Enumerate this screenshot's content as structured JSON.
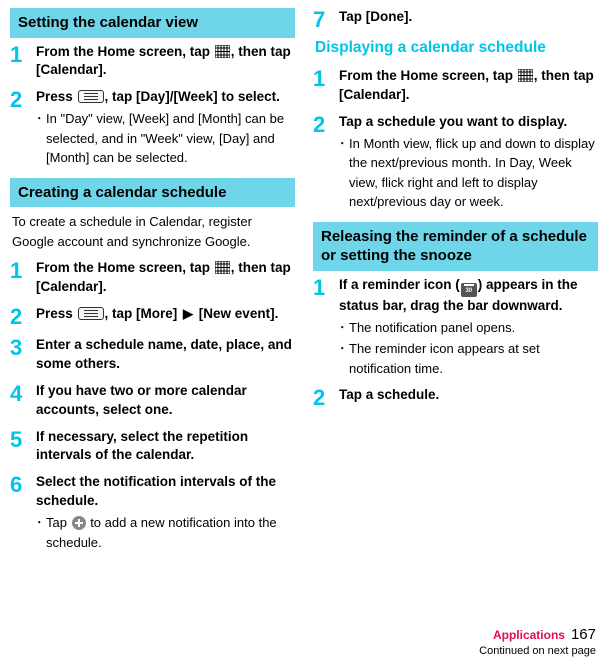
{
  "leftColumn": {
    "section1": {
      "header": "Setting the calendar view",
      "steps": [
        {
          "num": "1",
          "title_pre": "From the Home screen, tap ",
          "title_post": ", then tap [Calendar]."
        },
        {
          "num": "2",
          "title_pre": "Press ",
          "title_post": ", tap [Day]/[Week] to select.",
          "bullet": "In \"Day\" view, [Week] and [Month] can be selected, and in \"Week\" view, [Day] and [Month] can be selected."
        }
      ]
    },
    "section2": {
      "header": "Creating a calendar schedule",
      "intro": "To create a schedule in Calendar, register Google account and synchronize Google.",
      "steps": [
        {
          "num": "1",
          "title_pre": "From the Home screen, tap ",
          "title_post": ", then tap [Calendar]."
        },
        {
          "num": "2",
          "title_pre": "Press ",
          "title_mid": ", tap [More] ",
          "title_post": " [New event]."
        },
        {
          "num": "3",
          "title": "Enter a schedule name, date, place, and some others."
        },
        {
          "num": "4",
          "title": "If you have two or more calendar accounts, select one."
        },
        {
          "num": "5",
          "title": "If necessary, select the repetition intervals of the calendar."
        },
        {
          "num": "6",
          "title": "Select the notification intervals of the schedule.",
          "bullet_pre": "Tap ",
          "bullet_post": " to add a new notification into the schedule."
        }
      ]
    }
  },
  "rightColumn": {
    "topStep": {
      "num": "7",
      "title": "Tap [Done]."
    },
    "section1": {
      "title": "Displaying a calendar schedule",
      "steps": [
        {
          "num": "1",
          "title_pre": "From the Home screen, tap ",
          "title_post": ", then tap [Calendar]."
        },
        {
          "num": "2",
          "title": "Tap a schedule you want to display.",
          "bullet": "In Month view, flick up and down to display the next/previous month. In Day, Week view, flick right and left to display next/previous day or week."
        }
      ]
    },
    "section2": {
      "header": "Releasing the reminder of a schedule or setting the snooze",
      "steps": [
        {
          "num": "1",
          "title_pre": "If a reminder icon (",
          "title_post": ") appears in the status bar, drag the bar downward.",
          "bullets": [
            "The notification panel opens.",
            "The reminder icon appears at set notification time."
          ]
        },
        {
          "num": "2",
          "title": "Tap a schedule."
        }
      ]
    }
  },
  "footer": {
    "appLabel": "Applications",
    "page": "167",
    "cont": "Continued on next page"
  },
  "icons": {
    "arrow": "▶"
  }
}
